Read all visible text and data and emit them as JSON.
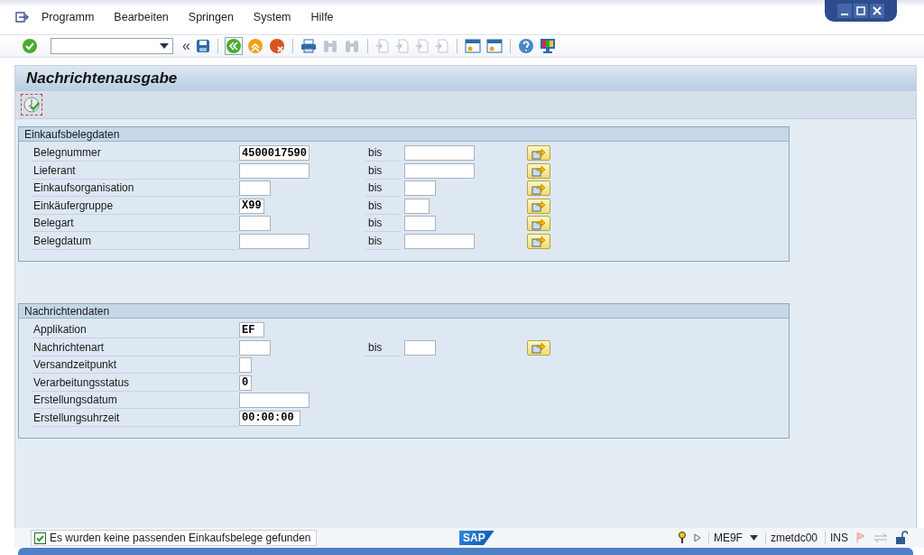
{
  "menu": [
    "Programm",
    "Bearbeiten",
    "Springen",
    "System",
    "Hilfe"
  ],
  "toolbar": [
    {
      "kind": "enter",
      "disabled": false
    },
    {
      "kind": "command"
    },
    {
      "kind": "chevrons",
      "label": "«",
      "disabled": false
    },
    {
      "kind": "save",
      "disabled": false
    },
    {
      "kind": "sep"
    },
    {
      "kind": "back",
      "disabled": false
    },
    {
      "kind": "exit",
      "disabled": false
    },
    {
      "kind": "cancel",
      "disabled": false
    },
    {
      "kind": "sep"
    },
    {
      "kind": "print",
      "disabled": false
    },
    {
      "kind": "find",
      "disabled": true
    },
    {
      "kind": "find",
      "disabled": true
    },
    {
      "kind": "sep"
    },
    {
      "kind": "page",
      "disabled": true
    },
    {
      "kind": "page",
      "disabled": true
    },
    {
      "kind": "page",
      "disabled": true
    },
    {
      "kind": "page",
      "disabled": true
    },
    {
      "kind": "sep"
    },
    {
      "kind": "window",
      "disabled": false
    },
    {
      "kind": "window",
      "disabled": false
    },
    {
      "kind": "sep"
    },
    {
      "kind": "help",
      "disabled": false
    },
    {
      "kind": "monitor",
      "disabled": false
    }
  ],
  "title": "Nachrichtenausgabe",
  "groups": [
    {
      "title": "Einkaufsbelegdaten",
      "rows": [
        {
          "label": "Belegnummer",
          "value": "4500017590",
          "kind": "long",
          "to": {
            "label": "bis",
            "kind": "long"
          }
        },
        {
          "label": "Lieferant",
          "kind": "long",
          "to": {
            "label": "bis",
            "kind": "long"
          }
        },
        {
          "label": "Einkaufsorganisation",
          "kind": "short",
          "to": {
            "label": "bis",
            "kind": "short"
          }
        },
        {
          "label": "Einkäufergruppe",
          "value": "X99",
          "kind": "tiny",
          "to": {
            "label": "bis",
            "kind": "tiny"
          }
        },
        {
          "label": "Belegart",
          "kind": "short",
          "to": {
            "label": "bis",
            "kind": "short"
          }
        },
        {
          "label": "Belegdatum",
          "kind": "long",
          "to": {
            "label": "bis",
            "kind": "long"
          }
        }
      ]
    },
    {
      "title": "Nachrichtendaten",
      "rows": [
        {
          "label": "Applikation",
          "value": "EF",
          "kind": "tiny"
        },
        {
          "label": "Nachrichtenart",
          "kind": "short",
          "to": {
            "label": "bis",
            "kind": "short"
          }
        },
        {
          "label": "Versandzeitpunkt",
          "kind": "char"
        },
        {
          "label": "Verarbeitungsstatus",
          "value": "0",
          "kind": "char"
        },
        {
          "label": "Erstellungsdatum",
          "kind": "long"
        },
        {
          "label": "Erstellungsuhrzeit",
          "value": "00:00:00",
          "kind": "time"
        }
      ]
    }
  ],
  "status_bar": {
    "message": "Es wurden keine passenden Einkaufsbelege gefunden",
    "logo": "SAP",
    "transaction": "ME9F",
    "server": "zmetdc00",
    "mode": "INS"
  }
}
